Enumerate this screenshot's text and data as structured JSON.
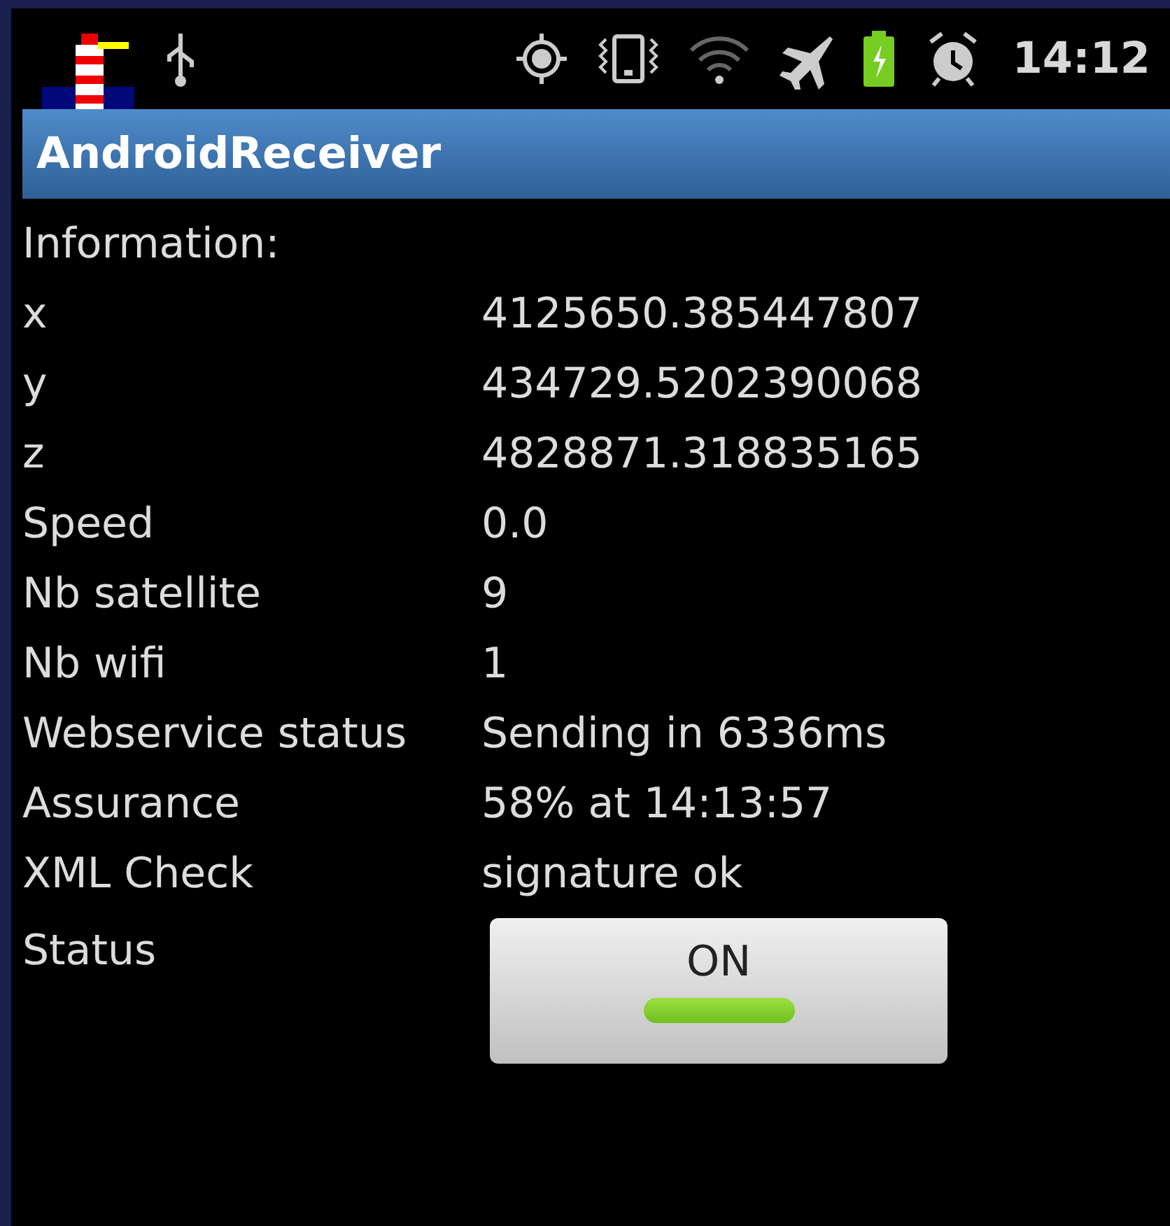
{
  "status_bar": {
    "time": "14:12"
  },
  "title_bar": {
    "title": "AndroidReceiver"
  },
  "heading": "Information:",
  "fields": [
    {
      "label": "x",
      "value": "4125650.385447807"
    },
    {
      "label": "y",
      "value": "434729.5202390068"
    },
    {
      "label": "z",
      "value": "4828871.318835165"
    },
    {
      "label": "Speed",
      "value": "0.0"
    },
    {
      "label": "Nb satellite",
      "value": "9"
    },
    {
      "label": "Nb wifi",
      "value": "1"
    },
    {
      "label": "Webservice status",
      "value": "Sending in 6336ms"
    },
    {
      "label": "Assurance",
      "value": "58% at 14:13:57"
    },
    {
      "label": "XML Check",
      "value": "signature ok"
    }
  ],
  "status_toggle": {
    "label": "Status",
    "text": "ON",
    "on": true
  }
}
